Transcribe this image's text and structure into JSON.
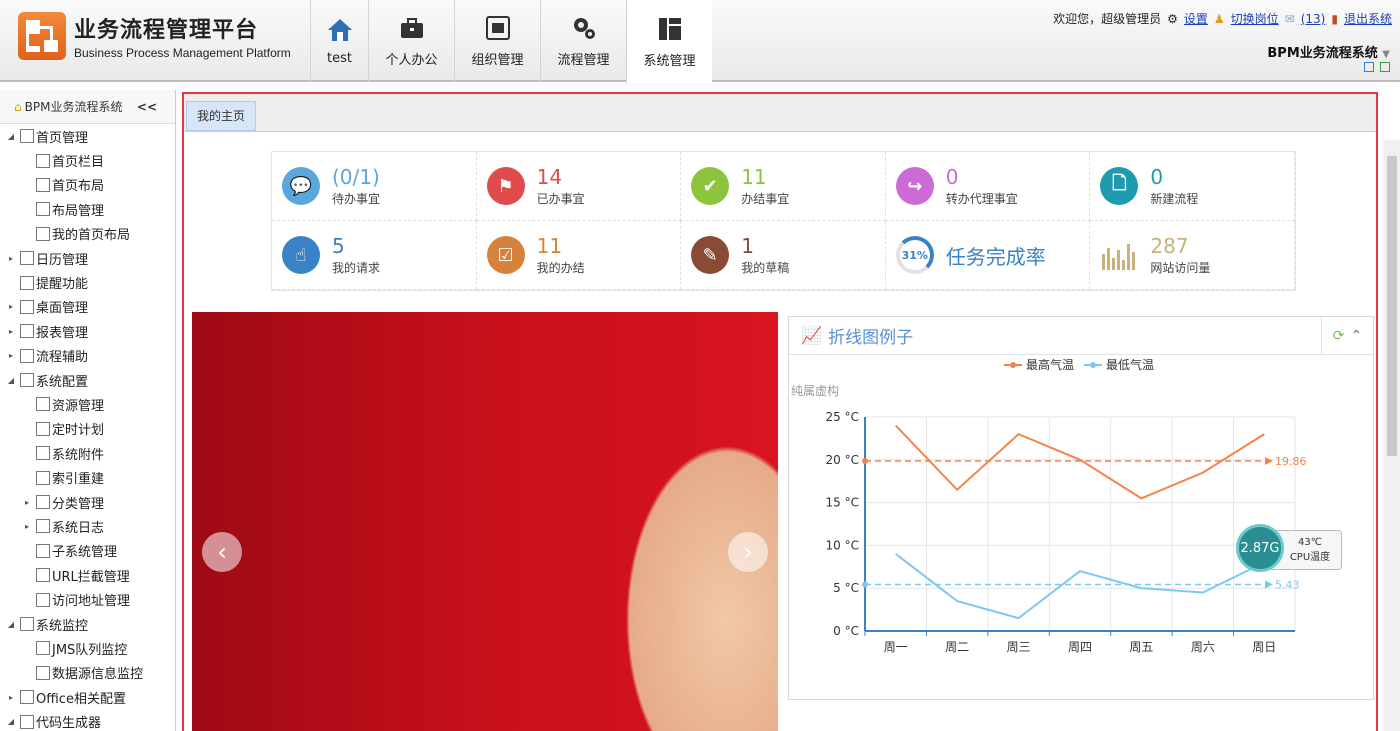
{
  "header": {
    "logo_title": "业务流程管理平台",
    "logo_subtitle": "Business Process Management Platform",
    "nav": [
      {
        "label": "test",
        "icon": "home-icon"
      },
      {
        "label": "个人办公",
        "icon": "briefcase-icon"
      },
      {
        "label": "组织管理",
        "icon": "org-icon"
      },
      {
        "label": "流程管理",
        "icon": "gears-icon"
      },
      {
        "label": "系统管理",
        "icon": "layout-icon"
      }
    ],
    "welcome": "欢迎您，超级管理员",
    "settings": "设置",
    "switch_post": "切换岗位",
    "messages": "(13)",
    "logout": "退出系统",
    "system_name": "BPM业务流程系统"
  },
  "sidebar": {
    "title": "BPM业务流程系统",
    "collapse": "<<",
    "items": [
      {
        "label": "首页管理",
        "level": 0,
        "arrow": "◢"
      },
      {
        "label": "首页栏目",
        "level": 1,
        "arrow": ""
      },
      {
        "label": "首页布局",
        "level": 1,
        "arrow": ""
      },
      {
        "label": "布局管理",
        "level": 1,
        "arrow": ""
      },
      {
        "label": "我的首页布局",
        "level": 1,
        "arrow": ""
      },
      {
        "label": "日历管理",
        "level": 0,
        "arrow": "▸"
      },
      {
        "label": "提醒功能",
        "level": 0,
        "arrow": ""
      },
      {
        "label": "桌面管理",
        "level": 0,
        "arrow": "▸"
      },
      {
        "label": "报表管理",
        "level": 0,
        "arrow": "▸"
      },
      {
        "label": "流程辅助",
        "level": 0,
        "arrow": "▸"
      },
      {
        "label": "系统配置",
        "level": 0,
        "arrow": "◢"
      },
      {
        "label": "资源管理",
        "level": 1,
        "arrow": ""
      },
      {
        "label": "定时计划",
        "level": 1,
        "arrow": ""
      },
      {
        "label": "系统附件",
        "level": 1,
        "arrow": ""
      },
      {
        "label": "索引重建",
        "level": 1,
        "arrow": ""
      },
      {
        "label": "分类管理",
        "level": 1,
        "arrow": "▸"
      },
      {
        "label": "系统日志",
        "level": 1,
        "arrow": "▸"
      },
      {
        "label": "子系统管理",
        "level": 1,
        "arrow": ""
      },
      {
        "label": "URL拦截管理",
        "level": 1,
        "arrow": ""
      },
      {
        "label": "访问地址管理",
        "level": 1,
        "arrow": ""
      },
      {
        "label": "系统监控",
        "level": 0,
        "arrow": "◢"
      },
      {
        "label": "JMS队列监控",
        "level": 1,
        "arrow": ""
      },
      {
        "label": "数据源信息监控",
        "level": 1,
        "arrow": ""
      },
      {
        "label": "Office相关配置",
        "level": 0,
        "arrow": "▸"
      },
      {
        "label": "代码生成器",
        "level": 0,
        "arrow": "◢"
      }
    ]
  },
  "tabs": {
    "home": "我的主页"
  },
  "stats": [
    {
      "num": "(0/1)",
      "label": "待办事宜",
      "color": "#5aa7de",
      "icon": "chat-icon"
    },
    {
      "num": "14",
      "label": "已办事宜",
      "color": "#e04b4b",
      "icon": "flag-icon"
    },
    {
      "num": "11",
      "label": "办结事宜",
      "color": "#8cc43e",
      "icon": "check-icon"
    },
    {
      "num": "0",
      "label": "转办代理事宜",
      "color": "#cc6bd6",
      "icon": "forward-icon"
    },
    {
      "num": "0",
      "label": "新建流程",
      "color": "#1f9bb0",
      "icon": "document-icon"
    },
    {
      "num": "5",
      "label": "我的请求",
      "color": "#3a82c6",
      "icon": "hand-icon"
    },
    {
      "num": "11",
      "label": "我的办结",
      "color": "#d6823c",
      "icon": "checkbox-icon"
    },
    {
      "num": "1",
      "label": "我的草稿",
      "color": "#8a4b34",
      "icon": "edit-icon"
    },
    {
      "num": "31%",
      "label": "任务完成率",
      "color": "#3a82c6",
      "icon": "progress-ring-icon",
      "value": 0.31
    },
    {
      "num": "287",
      "label": "网站访问量",
      "color": "#c8b27c",
      "icon": "bars-icon"
    }
  ],
  "chart_panel": {
    "title": "折线图例子",
    "refresh": "⟳",
    "collapse": "⌃"
  },
  "chart_data": {
    "type": "line",
    "categories": [
      "周一",
      "周二",
      "周三",
      "周四",
      "周五",
      "周六",
      "周日"
    ],
    "series": [
      {
        "name": "最高气温",
        "color": "#f4834b",
        "values": [
          24,
          16.5,
          23,
          20,
          15.5,
          18.5,
          23
        ],
        "avg": 19.86
      },
      {
        "name": "最低气温",
        "color": "#7ec8ef",
        "values": [
          9,
          3.5,
          1.5,
          7,
          5,
          4.5,
          8
        ],
        "avg": 5.43
      }
    ],
    "subtitle": "纯属虚构",
    "yticks": [
      "0 °C",
      "5 °C",
      "10 °C",
      "15 °C",
      "20 °C",
      "25 °C"
    ],
    "ylim": [
      0,
      25
    ],
    "avg_labels": [
      "19.86",
      "5.43"
    ]
  },
  "cpu": {
    "usage": "2.87G",
    "temp": "43℃",
    "label": "CPU温度"
  }
}
